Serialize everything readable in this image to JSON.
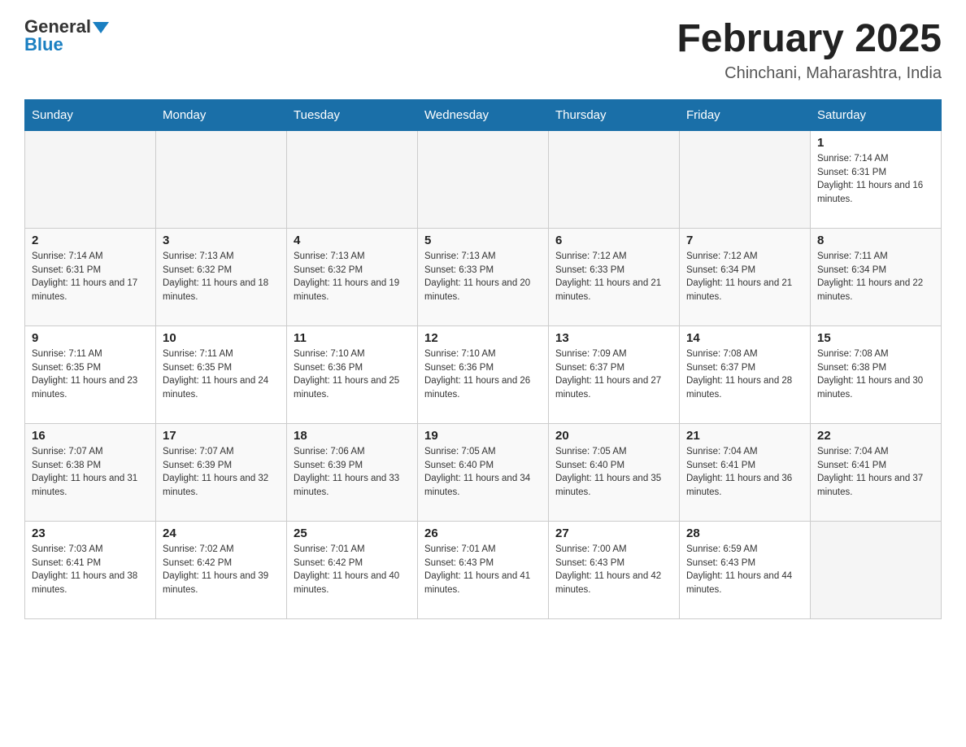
{
  "logo": {
    "general": "General",
    "blue": "Blue"
  },
  "title": {
    "month_year": "February 2025",
    "location": "Chinchani, Maharashtra, India"
  },
  "days_of_week": [
    "Sunday",
    "Monday",
    "Tuesday",
    "Wednesday",
    "Thursday",
    "Friday",
    "Saturday"
  ],
  "weeks": [
    [
      {
        "day": "",
        "info": ""
      },
      {
        "day": "",
        "info": ""
      },
      {
        "day": "",
        "info": ""
      },
      {
        "day": "",
        "info": ""
      },
      {
        "day": "",
        "info": ""
      },
      {
        "day": "",
        "info": ""
      },
      {
        "day": "1",
        "info": "Sunrise: 7:14 AM\nSunset: 6:31 PM\nDaylight: 11 hours and 16 minutes."
      }
    ],
    [
      {
        "day": "2",
        "info": "Sunrise: 7:14 AM\nSunset: 6:31 PM\nDaylight: 11 hours and 17 minutes."
      },
      {
        "day": "3",
        "info": "Sunrise: 7:13 AM\nSunset: 6:32 PM\nDaylight: 11 hours and 18 minutes."
      },
      {
        "day": "4",
        "info": "Sunrise: 7:13 AM\nSunset: 6:32 PM\nDaylight: 11 hours and 19 minutes."
      },
      {
        "day": "5",
        "info": "Sunrise: 7:13 AM\nSunset: 6:33 PM\nDaylight: 11 hours and 20 minutes."
      },
      {
        "day": "6",
        "info": "Sunrise: 7:12 AM\nSunset: 6:33 PM\nDaylight: 11 hours and 21 minutes."
      },
      {
        "day": "7",
        "info": "Sunrise: 7:12 AM\nSunset: 6:34 PM\nDaylight: 11 hours and 21 minutes."
      },
      {
        "day": "8",
        "info": "Sunrise: 7:11 AM\nSunset: 6:34 PM\nDaylight: 11 hours and 22 minutes."
      }
    ],
    [
      {
        "day": "9",
        "info": "Sunrise: 7:11 AM\nSunset: 6:35 PM\nDaylight: 11 hours and 23 minutes."
      },
      {
        "day": "10",
        "info": "Sunrise: 7:11 AM\nSunset: 6:35 PM\nDaylight: 11 hours and 24 minutes."
      },
      {
        "day": "11",
        "info": "Sunrise: 7:10 AM\nSunset: 6:36 PM\nDaylight: 11 hours and 25 minutes."
      },
      {
        "day": "12",
        "info": "Sunrise: 7:10 AM\nSunset: 6:36 PM\nDaylight: 11 hours and 26 minutes."
      },
      {
        "day": "13",
        "info": "Sunrise: 7:09 AM\nSunset: 6:37 PM\nDaylight: 11 hours and 27 minutes."
      },
      {
        "day": "14",
        "info": "Sunrise: 7:08 AM\nSunset: 6:37 PM\nDaylight: 11 hours and 28 minutes."
      },
      {
        "day": "15",
        "info": "Sunrise: 7:08 AM\nSunset: 6:38 PM\nDaylight: 11 hours and 30 minutes."
      }
    ],
    [
      {
        "day": "16",
        "info": "Sunrise: 7:07 AM\nSunset: 6:38 PM\nDaylight: 11 hours and 31 minutes."
      },
      {
        "day": "17",
        "info": "Sunrise: 7:07 AM\nSunset: 6:39 PM\nDaylight: 11 hours and 32 minutes."
      },
      {
        "day": "18",
        "info": "Sunrise: 7:06 AM\nSunset: 6:39 PM\nDaylight: 11 hours and 33 minutes."
      },
      {
        "day": "19",
        "info": "Sunrise: 7:05 AM\nSunset: 6:40 PM\nDaylight: 11 hours and 34 minutes."
      },
      {
        "day": "20",
        "info": "Sunrise: 7:05 AM\nSunset: 6:40 PM\nDaylight: 11 hours and 35 minutes."
      },
      {
        "day": "21",
        "info": "Sunrise: 7:04 AM\nSunset: 6:41 PM\nDaylight: 11 hours and 36 minutes."
      },
      {
        "day": "22",
        "info": "Sunrise: 7:04 AM\nSunset: 6:41 PM\nDaylight: 11 hours and 37 minutes."
      }
    ],
    [
      {
        "day": "23",
        "info": "Sunrise: 7:03 AM\nSunset: 6:41 PM\nDaylight: 11 hours and 38 minutes."
      },
      {
        "day": "24",
        "info": "Sunrise: 7:02 AM\nSunset: 6:42 PM\nDaylight: 11 hours and 39 minutes."
      },
      {
        "day": "25",
        "info": "Sunrise: 7:01 AM\nSunset: 6:42 PM\nDaylight: 11 hours and 40 minutes."
      },
      {
        "day": "26",
        "info": "Sunrise: 7:01 AM\nSunset: 6:43 PM\nDaylight: 11 hours and 41 minutes."
      },
      {
        "day": "27",
        "info": "Sunrise: 7:00 AM\nSunset: 6:43 PM\nDaylight: 11 hours and 42 minutes."
      },
      {
        "day": "28",
        "info": "Sunrise: 6:59 AM\nSunset: 6:43 PM\nDaylight: 11 hours and 44 minutes."
      },
      {
        "day": "",
        "info": ""
      }
    ]
  ]
}
